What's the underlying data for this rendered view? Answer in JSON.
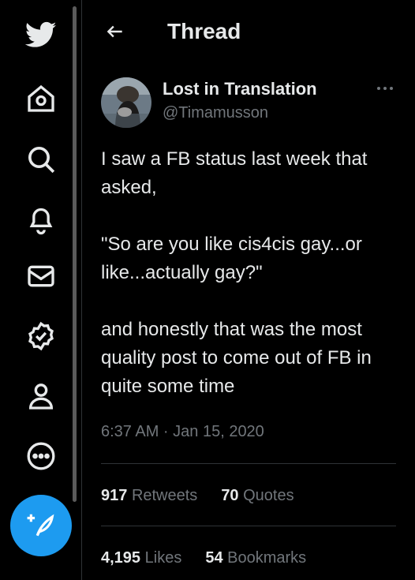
{
  "sidebar": {
    "items": [
      {
        "icon": "twitter-logo-icon"
      },
      {
        "icon": "home-icon"
      },
      {
        "icon": "search-icon"
      },
      {
        "icon": "notifications-bell-icon"
      },
      {
        "icon": "messages-mail-icon"
      },
      {
        "icon": "verified-badge-icon"
      },
      {
        "icon": "profile-icon"
      },
      {
        "icon": "more-circle-icon"
      }
    ],
    "compose_icon": "compose-feather-icon",
    "accent": "#1d9bf0"
  },
  "header": {
    "title": "Thread"
  },
  "tweet": {
    "author_name": "Lost in Translation",
    "author_handle": "@Timamusson",
    "text": "I saw a FB status last week that asked,\n\n\"So are you like cis4cis gay...or like...actually gay?\"\n\nand honestly that was the most quality post to come out of FB in quite some time",
    "timestamp": "6:37 AM · Jan 15, 2020",
    "stats": {
      "retweets_count": "917",
      "retweets_label": "Retweets",
      "quotes_count": "70",
      "quotes_label": "Quotes",
      "likes_count": "4,195",
      "likes_label": "Likes",
      "bookmarks_count": "54",
      "bookmarks_label": "Bookmarks"
    }
  },
  "colors": {
    "background": "#000000",
    "text": "#e7e9ea",
    "muted": "#71767b",
    "divider": "#2f3336"
  }
}
